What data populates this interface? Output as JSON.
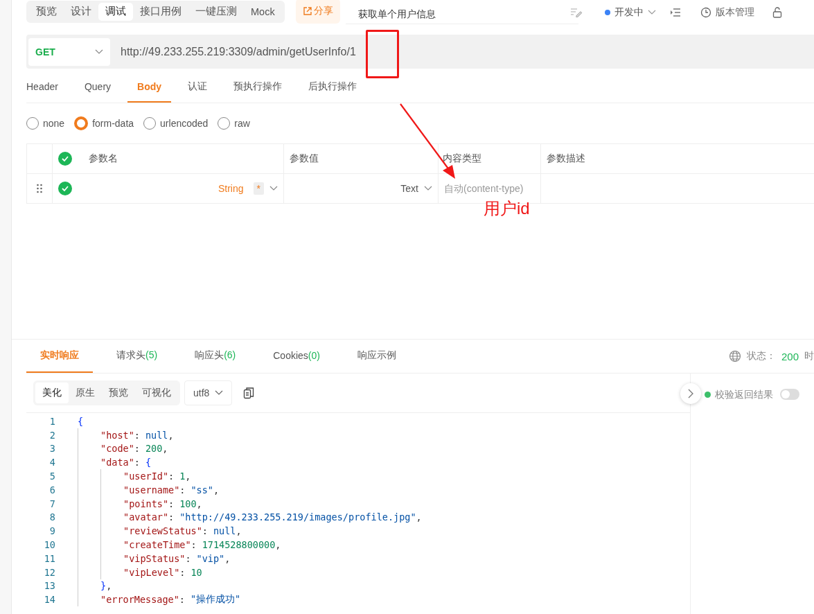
{
  "top_tabs": [
    {
      "label": "预览",
      "selected": false
    },
    {
      "label": "设计",
      "selected": false
    },
    {
      "label": "调试",
      "selected": true
    },
    {
      "label": "接口用例",
      "selected": false
    },
    {
      "label": "一键压测",
      "selected": false
    },
    {
      "label": "Mock",
      "selected": false
    }
  ],
  "share_button": "分享",
  "api_name": "获取单个用户信息",
  "status": {
    "label": "开发中",
    "color": "#3b82f6"
  },
  "version_button": "版本管理",
  "request": {
    "method": "GET",
    "url": "http://49.233.255.219:3309/admin/getUserInfo/1"
  },
  "request_tabs": [
    {
      "label": "Header",
      "selected": false
    },
    {
      "label": "Query",
      "selected": false
    },
    {
      "label": "Body",
      "selected": true
    },
    {
      "label": "认证",
      "selected": false
    },
    {
      "label": "预执行操作",
      "selected": false
    },
    {
      "label": "后执行操作",
      "selected": false
    }
  ],
  "body_types": [
    {
      "label": "none",
      "selected": false
    },
    {
      "label": "form-data",
      "selected": true
    },
    {
      "label": "urlencoded",
      "selected": false
    },
    {
      "label": "raw",
      "selected": false
    }
  ],
  "params_table": {
    "all_checked": true,
    "columns": [
      "参数名",
      "参数值",
      "内容类型",
      "参数描述"
    ],
    "rows": [
      {
        "checked": true,
        "type": "String",
        "required": "*",
        "value_type": "Text",
        "content_type_placeholder": "自动(content-type)"
      }
    ]
  },
  "annotation": {
    "label": "用户id"
  },
  "response_tabs": [
    {
      "label": "实时响应",
      "selected": true
    },
    {
      "label": "请求头",
      "count": "(5)",
      "selected": false
    },
    {
      "label": "响应头",
      "count": "(6)",
      "selected": false
    },
    {
      "label": "Cookies",
      "count": "(0)",
      "selected": false
    },
    {
      "label": "响应示例",
      "selected": false
    }
  ],
  "response_status": {
    "label": "状态：",
    "code": "200",
    "next_label": "时"
  },
  "view_tabs": [
    {
      "label": "美化",
      "selected": true
    },
    {
      "label": "原生",
      "selected": false
    },
    {
      "label": "预览",
      "selected": false
    },
    {
      "label": "可视化",
      "selected": false
    }
  ],
  "encoding": "utf8",
  "validate": {
    "label": "校验返回结果",
    "on": false
  },
  "code_lines": [
    {
      "n": "1",
      "tokens": [
        {
          "kind": "brace",
          "text": "{"
        }
      ]
    },
    {
      "n": "2",
      "tokens": [
        {
          "kind": "key",
          "text": "\"host\""
        },
        {
          "kind": "colon",
          "text": ":"
        },
        {
          "kind": "null",
          "text": "null"
        },
        {
          "kind": "punct",
          "text": ","
        }
      ]
    },
    {
      "n": "3",
      "tokens": [
        {
          "kind": "key",
          "text": "\"code\""
        },
        {
          "kind": "colon",
          "text": ":"
        },
        {
          "kind": "number",
          "text": "200"
        },
        {
          "kind": "punct",
          "text": ","
        }
      ]
    },
    {
      "n": "4",
      "tokens": [
        {
          "kind": "key",
          "text": "\"data\""
        },
        {
          "kind": "colon",
          "text": ":"
        },
        {
          "kind": "brace",
          "text": "{"
        }
      ],
      "children": [
        {
          "n": "5",
          "tokens": [
            {
              "kind": "key",
              "text": "\"userId\""
            },
            {
              "kind": "colon",
              "text": ":"
            },
            {
              "kind": "number",
              "text": "1"
            },
            {
              "kind": "punct",
              "text": ","
            }
          ]
        },
        {
          "n": "6",
          "tokens": [
            {
              "kind": "key",
              "text": "\"username\""
            },
            {
              "kind": "colon",
              "text": ":"
            },
            {
              "kind": "string",
              "text": "\"ss\""
            },
            {
              "kind": "punct",
              "text": ","
            }
          ]
        },
        {
          "n": "7",
          "tokens": [
            {
              "kind": "key",
              "text": "\"points\""
            },
            {
              "kind": "colon",
              "text": ":"
            },
            {
              "kind": "number",
              "text": "100"
            },
            {
              "kind": "punct",
              "text": ","
            }
          ]
        },
        {
          "n": "8",
          "tokens": [
            {
              "kind": "key",
              "text": "\"avatar\""
            },
            {
              "kind": "colon",
              "text": ":"
            },
            {
              "kind": "string",
              "text": "\"http://49.233.255.219/images/profile.jpg\""
            },
            {
              "kind": "punct",
              "text": ","
            }
          ]
        },
        {
          "n": "9",
          "tokens": [
            {
              "kind": "key",
              "text": "\"reviewStatus\""
            },
            {
              "kind": "colon",
              "text": ":"
            },
            {
              "kind": "null",
              "text": "null"
            },
            {
              "kind": "punct",
              "text": ","
            }
          ]
        },
        {
          "n": "10",
          "tokens": [
            {
              "kind": "key",
              "text": "\"createTime\""
            },
            {
              "kind": "colon",
              "text": ":"
            },
            {
              "kind": "number",
              "text": "1714528800000"
            },
            {
              "kind": "punct",
              "text": ","
            }
          ]
        },
        {
          "n": "11",
          "tokens": [
            {
              "kind": "key",
              "text": "\"vipStatus\""
            },
            {
              "kind": "colon",
              "text": ":"
            },
            {
              "kind": "string",
              "text": "\"vip\""
            },
            {
              "kind": "punct",
              "text": ","
            }
          ]
        },
        {
          "n": "12",
          "tokens": [
            {
              "kind": "key",
              "text": "\"vipLevel\""
            },
            {
              "kind": "colon",
              "text": ":"
            },
            {
              "kind": "number",
              "text": "10"
            }
          ]
        }
      ]
    },
    {
      "n": "13",
      "tokens": [
        {
          "kind": "brace",
          "text": "}"
        },
        {
          "kind": "punct",
          "text": ","
        }
      ]
    },
    {
      "n": "14",
      "tokens": [
        {
          "kind": "key",
          "text": "\"errorMessage\""
        },
        {
          "kind": "colon",
          "text": ":"
        },
        {
          "kind": "string",
          "text": "\"操作成功\""
        }
      ]
    }
  ]
}
